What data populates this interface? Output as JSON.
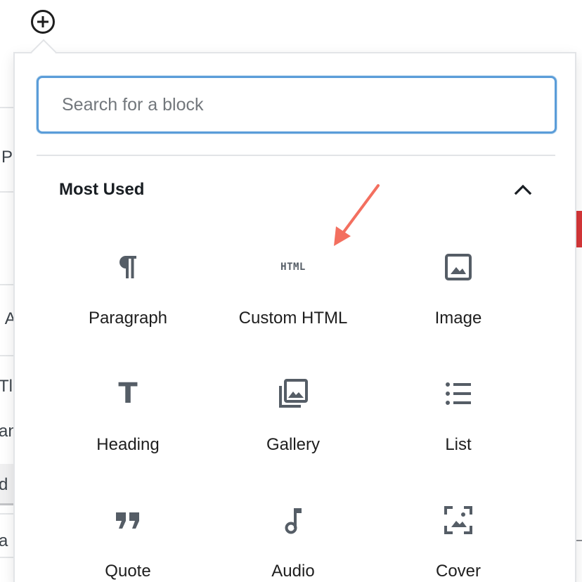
{
  "inserter": {
    "toggle_icon": "plus-circle-icon"
  },
  "background": {
    "fragments": [
      "P",
      "n A",
      "Tl",
      "an",
      "d",
      "ra"
    ]
  },
  "search": {
    "placeholder": "Search for a block",
    "value": ""
  },
  "panel": {
    "title": "Most Used",
    "expanded": true,
    "toggle_icon": "chevron-up-icon"
  },
  "blocks": [
    {
      "label": "Paragraph",
      "icon": "paragraph-icon"
    },
    {
      "label": "Custom HTML",
      "icon": "html-icon",
      "icon_text": "HTML"
    },
    {
      "label": "Image",
      "icon": "image-icon"
    },
    {
      "label": "Heading",
      "icon": "heading-icon",
      "icon_text": "T"
    },
    {
      "label": "Gallery",
      "icon": "gallery-icon"
    },
    {
      "label": "List",
      "icon": "list-icon"
    },
    {
      "label": "Quote",
      "icon": "quote-icon",
      "icon_text": "99"
    },
    {
      "label": "Audio",
      "icon": "audio-icon"
    },
    {
      "label": "Cover",
      "icon": "cover-icon"
    }
  ],
  "colors": {
    "focus_border": "#5b9dd9",
    "icon": "#555d66",
    "annotation_arrow": "#f36f5f",
    "background_red": "#d63638"
  }
}
